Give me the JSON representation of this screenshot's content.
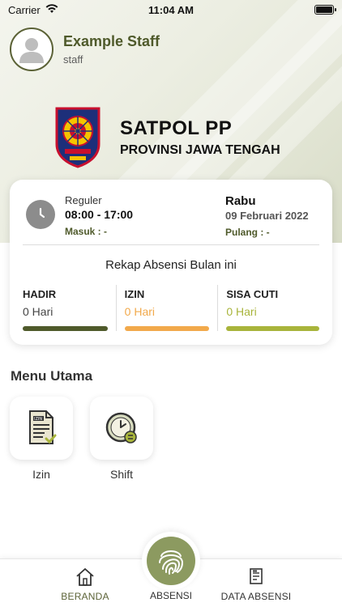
{
  "status_bar": {
    "carrier": "Carrier",
    "time": "11:04 AM"
  },
  "profile": {
    "name": "Example Staff",
    "role": "staff"
  },
  "brand": {
    "title": "SATPOL PP",
    "subtitle": "PROVINSI JAWA TENGAH"
  },
  "schedule": {
    "shift_type": "Reguler",
    "hours": "08:00 - 17:00",
    "check_in": "Masuk : -",
    "day": "Rabu",
    "date": "09 Februari 2022",
    "check_out": "Pulang : -"
  },
  "recap": {
    "title": "Rekap Absensi Bulan ini",
    "stats": [
      {
        "label": "HADIR",
        "value": "0 Hari",
        "color": "#4f5a2b"
      },
      {
        "label": "IZIN",
        "value": "0 Hari",
        "color": "#f2a94b"
      },
      {
        "label": "SISA CUTI",
        "value": "0 Hari",
        "color": "#a8b43b"
      }
    ]
  },
  "menu": {
    "title": "Menu Utama",
    "items": [
      {
        "label": "Izin",
        "icon": "permit-document-icon"
      },
      {
        "label": "Shift",
        "icon": "shift-clock-icon"
      }
    ]
  },
  "bottom_nav": {
    "items": [
      {
        "label": "BERANDA",
        "icon": "home-icon",
        "active": true
      },
      {
        "label": "ABSENSI",
        "icon": "fingerprint-icon"
      },
      {
        "label": "DATA ABSENSI",
        "icon": "report-icon"
      }
    ]
  },
  "colors": {
    "primary": "#5b6236",
    "accent_green": "#8c9a60",
    "izin_orange": "#f2a94b",
    "cuti_olive": "#a8b43b"
  }
}
